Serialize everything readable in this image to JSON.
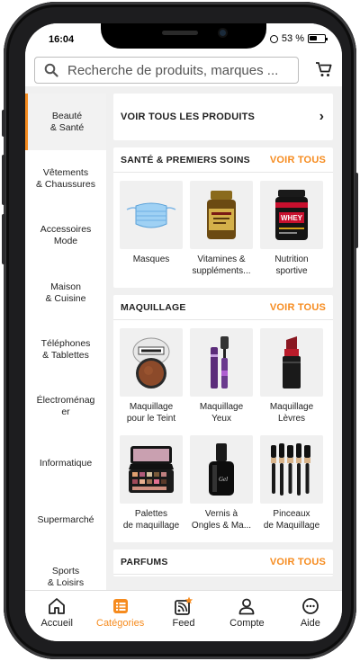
{
  "status": {
    "time": "16:04",
    "battery": "53 %",
    "battery_level": 0.53
  },
  "search": {
    "placeholder": "Recherche de produits, marques ..."
  },
  "colors": {
    "accent": "#f68b1e",
    "background": "#f0f0f0"
  },
  "sidebar": {
    "items": [
      {
        "label": "Beauté\n& Santé",
        "active": true
      },
      {
        "label": "Vêtements\n& Chaussures"
      },
      {
        "label": "Accessoires\nMode"
      },
      {
        "label": "Maison\n& Cuisine"
      },
      {
        "label": "Téléphones\n& Tablettes"
      },
      {
        "label": "Électroménag\ner"
      },
      {
        "label": "Informatique"
      },
      {
        "label": "Supermarché"
      },
      {
        "label": "Sports\n& Loisirs"
      }
    ]
  },
  "main": {
    "all_products": "VOIR TOUS LES PRODUITS",
    "sections": [
      {
        "title": "SANTÉ & PREMIERS SOINS",
        "link": "VOIR TOUS",
        "items": [
          {
            "label": "Masques",
            "icon": "face-mask-icon"
          },
          {
            "label": "Vitamines &\nsuppléments...",
            "icon": "vitamin-bottle-icon"
          },
          {
            "label": "Nutrition\nsportive",
            "icon": "whey-protein-icon"
          }
        ]
      },
      {
        "title": "MAQUILLAGE",
        "link": "VOIR TOUS",
        "items": [
          {
            "label": "Maquillage\npour le Teint",
            "icon": "compact-powder-icon"
          },
          {
            "label": "Maquillage\nYeux",
            "icon": "mascara-icon"
          },
          {
            "label": "Maquillage\nLèvres",
            "icon": "lipstick-icon"
          },
          {
            "label": "Palettes\nde maquillage",
            "icon": "makeup-palette-icon"
          },
          {
            "label": "Vernis à\nOngles & Ma...",
            "icon": "nail-polish-icon"
          },
          {
            "label": "Pinceaux\nde Maquillage",
            "icon": "makeup-brushes-icon"
          }
        ]
      },
      {
        "title": "PARFUMS",
        "link": "VOIR TOUS"
      }
    ]
  },
  "tabs": [
    {
      "label": "Accueil",
      "icon": "home-icon"
    },
    {
      "label": "Catégories",
      "icon": "categories-icon",
      "active": true
    },
    {
      "label": "Feed",
      "icon": "feed-icon"
    },
    {
      "label": "Compte",
      "icon": "account-icon"
    },
    {
      "label": "Aide",
      "icon": "help-icon"
    }
  ]
}
